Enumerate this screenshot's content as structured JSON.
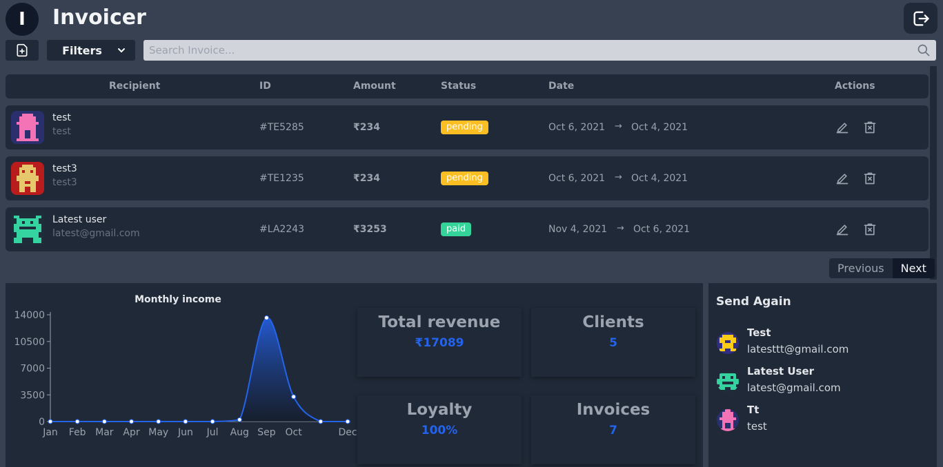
{
  "app": {
    "logo_letter": "I",
    "title": "Invoicer"
  },
  "toolbar": {
    "filters_label": "Filters",
    "search_placeholder": "Search Invoice..."
  },
  "table": {
    "headers": {
      "recipient": "Recipient",
      "id": "ID",
      "amount": "Amount",
      "status": "Status",
      "date": "Date",
      "actions": "Actions"
    },
    "rows": [
      {
        "name": "test",
        "email": "test",
        "id": "#TE5285",
        "amount": "₹234",
        "status": "pending",
        "date_from": "Oct 6, 2021",
        "arrow": "→",
        "date_to": "Oct 4, 2021"
      },
      {
        "name": "test3",
        "email": "test3",
        "id": "#TE1235",
        "amount": "₹234",
        "status": "pending",
        "date_from": "Oct 6, 2021",
        "arrow": "→",
        "date_to": "Oct 4, 2021"
      },
      {
        "name": "Latest user",
        "email": "latest@gmail.com",
        "id": "#LA2243",
        "amount": "₹3253",
        "status": "paid",
        "date_from": "Nov 4, 2021",
        "arrow": "→",
        "date_to": "Oct 6, 2021"
      }
    ]
  },
  "pagination": {
    "previous": "Previous",
    "next": "Next"
  },
  "chart_data": {
    "type": "area",
    "title": "Monthly income",
    "categories": [
      "Jan",
      "Feb",
      "Mar",
      "Apr",
      "May",
      "Jun",
      "Jul",
      "Aug",
      "Sep",
      "Oct",
      "Nov",
      "Dec"
    ],
    "values": [
      0,
      0,
      0,
      0,
      0,
      0,
      0,
      234,
      13600,
      3253,
      0,
      0
    ],
    "yticks": [
      "14000",
      "10500",
      "7000",
      "3500",
      "0"
    ],
    "ylim": [
      0,
      14000
    ],
    "color": "#2563eb",
    "grid": false
  },
  "stats": {
    "total_revenue": {
      "label": "Total revenue",
      "value": "₹17089"
    },
    "clients": {
      "label": "Clients",
      "value": "5"
    },
    "loyalty": {
      "label": "Loyalty",
      "value": "100%"
    },
    "invoices": {
      "label": "Invoices",
      "value": "7"
    }
  },
  "send_again": {
    "title": "Send Again",
    "contacts": [
      {
        "name": "Test",
        "email": "latesttt@gmail.com"
      },
      {
        "name": "Latest User",
        "email": "latest@gmail.com"
      },
      {
        "name": "Tt",
        "email": "test"
      }
    ]
  }
}
